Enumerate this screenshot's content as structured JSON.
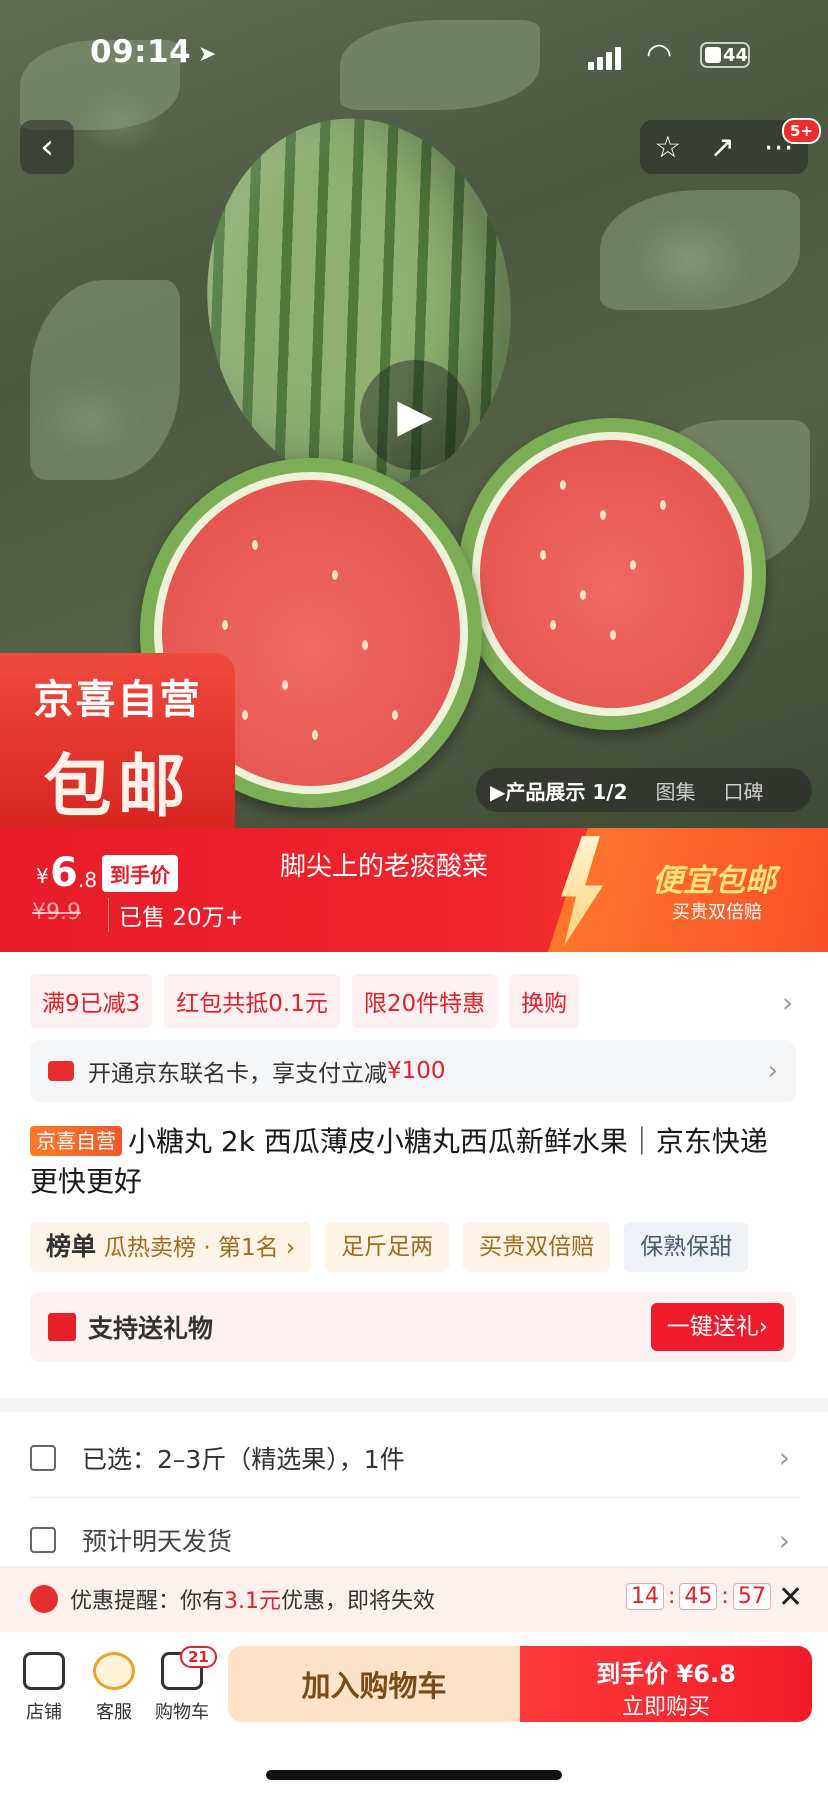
{
  "status": {
    "time": "09:14",
    "battery": "44"
  },
  "nav": {
    "badge": "5+"
  },
  "sticker": {
    "line1": "京喜自营",
    "line2": "包邮"
  },
  "gallery": {
    "tabs": [
      "▶产品展示 1/2",
      "图集",
      "口碑"
    ]
  },
  "price": {
    "currency": "¥",
    "integer": "6",
    "decimal": ".8",
    "tag": "到手价",
    "original": "¥9.9",
    "sold": "已售 20万+",
    "slogan": "脚尖上的老痰酸菜",
    "promo_title": "便宜包邮",
    "promo_sub": "买贵双倍赔"
  },
  "promos": [
    "满9已减3",
    "红包共抵0.1元",
    "限20件特惠",
    "换购"
  ],
  "card": {
    "text": "开通京东联名卡，享支付立减",
    "amount": "¥100"
  },
  "product": {
    "badge": "京喜自营",
    "title": "小糖丸 2k 西瓜薄皮小糖丸西瓜新鲜水果｜京东快递 更快更好"
  },
  "chips": {
    "rank_label": "榜单",
    "rank_text": "瓜热卖榜 · 第1名 ›",
    "c1": "足斤足两",
    "c2": "买贵双倍赔",
    "c3": "保熟保甜"
  },
  "gift": {
    "text": "支持送礼物",
    "button": "一键送礼›"
  },
  "rows": {
    "selected": "已选：2–3斤（精选果），1件",
    "ship": "预计明天发货"
  },
  "reminder": {
    "prefix": "优惠提醒：你有",
    "amount": "3.1元",
    "suffix": "优惠，即将失效",
    "h": "14",
    "m": "45",
    "s": "57"
  },
  "bottom": {
    "shop": "店铺",
    "service": "客服",
    "cart": "购物车",
    "cart_count": "21",
    "add_cart": "加入购物车",
    "buy_l1": "到手价 ¥6.8",
    "buy_l2": "立即购买"
  },
  "colors": {
    "accent": "#e61f28",
    "orange": "#f9502a"
  }
}
